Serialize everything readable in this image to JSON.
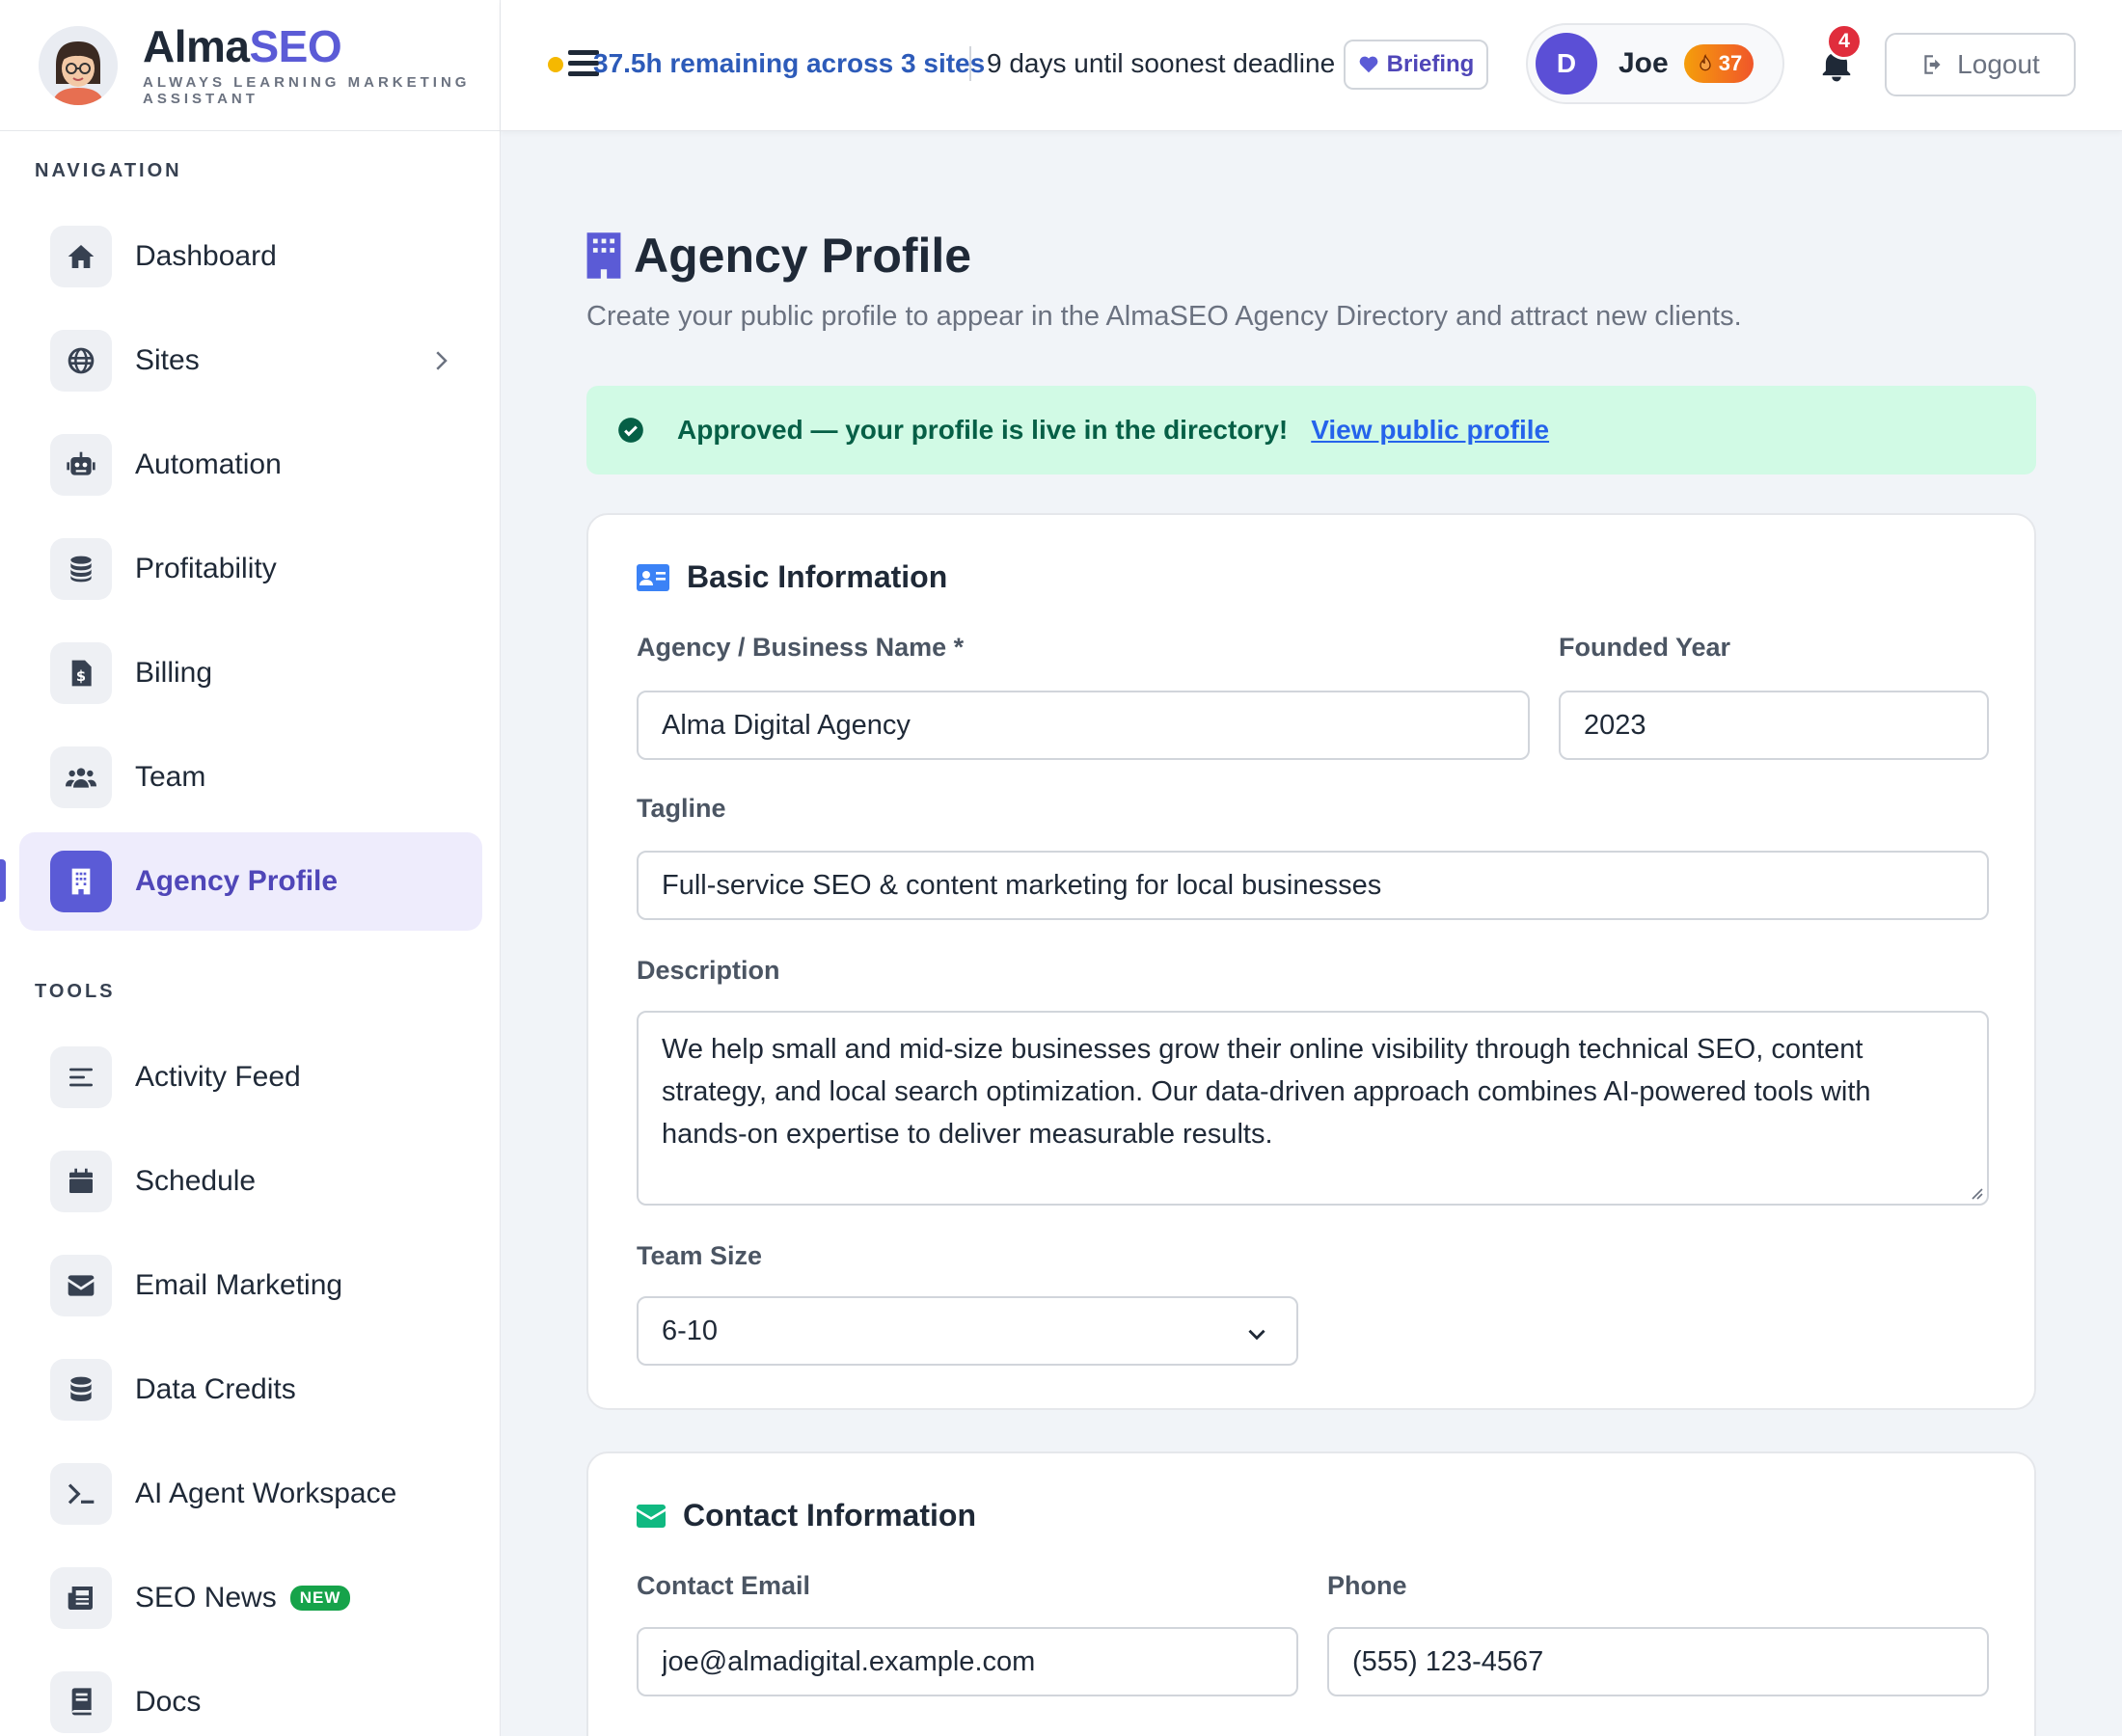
{
  "brand": {
    "name_a": "Alma",
    "name_b": "SEO",
    "tagline": "ALWAYS LEARNING MARKETING ASSISTANT"
  },
  "sidebar": {
    "nav_label": "NAVIGATION",
    "tools_label": "TOOLS",
    "items": [
      {
        "label": "Dashboard",
        "icon": "home-icon"
      },
      {
        "label": "Sites",
        "icon": "globe-icon"
      },
      {
        "label": "Automation",
        "icon": "robot-icon"
      },
      {
        "label": "Profitability",
        "icon": "coins-icon"
      },
      {
        "label": "Billing",
        "icon": "invoice-icon"
      },
      {
        "label": "Team",
        "icon": "users-icon"
      },
      {
        "label": "Agency Profile",
        "icon": "building-icon"
      }
    ],
    "tools": [
      {
        "label": "Activity Feed",
        "icon": "list-icon"
      },
      {
        "label": "Schedule",
        "icon": "calendar-icon"
      },
      {
        "label": "Email Marketing",
        "icon": "envelope-icon"
      },
      {
        "label": "Data Credits",
        "icon": "database-icon"
      },
      {
        "label": "AI Agent Workspace",
        "icon": "terminal-icon"
      },
      {
        "label": "SEO News",
        "icon": "newspaper-icon",
        "badge": "NEW"
      },
      {
        "label": "Docs",
        "icon": "book-icon"
      }
    ]
  },
  "topbar": {
    "remaining": "37.5h remaining across 3 sites",
    "deadline": "9 days until soonest deadline",
    "briefing": "Briefing",
    "user_initial": "D",
    "user_name": "Joe",
    "streak": "37",
    "notifications": "4",
    "logout": "Logout"
  },
  "main": {
    "title": "Agency Profile",
    "subtitle": "Create your public profile to appear in the AlmaSEO Agency Directory and attract new clients.",
    "alert_message": "Approved — your profile is live in the directory!",
    "alert_link": "View public profile"
  },
  "basic": {
    "title": "Basic Information",
    "name_label": "Agency / Business Name *",
    "name_value": "Alma Digital Agency",
    "year_label": "Founded Year",
    "year_value": "2023",
    "tagline_label": "Tagline",
    "tagline_value": "Full-service SEO & content marketing for local businesses",
    "desc_label": "Description",
    "desc_value": "We help small and mid-size businesses grow their online visibility through technical SEO, content strategy, and local search optimization. Our data-driven approach combines AI-powered tools with hands-on expertise to deliver measurable results.",
    "team_label": "Team Size",
    "team_value": "6-10"
  },
  "contact": {
    "title": "Contact Information",
    "email_label": "Contact Email",
    "email_value": "joe@almadigital.example.com",
    "phone_label": "Phone",
    "phone_value": "(555) 123-4567"
  },
  "colors": {
    "accent": "#5b5bd6",
    "success_bg": "#d1fae5",
    "success_text": "#065f46",
    "link": "#2563eb"
  }
}
